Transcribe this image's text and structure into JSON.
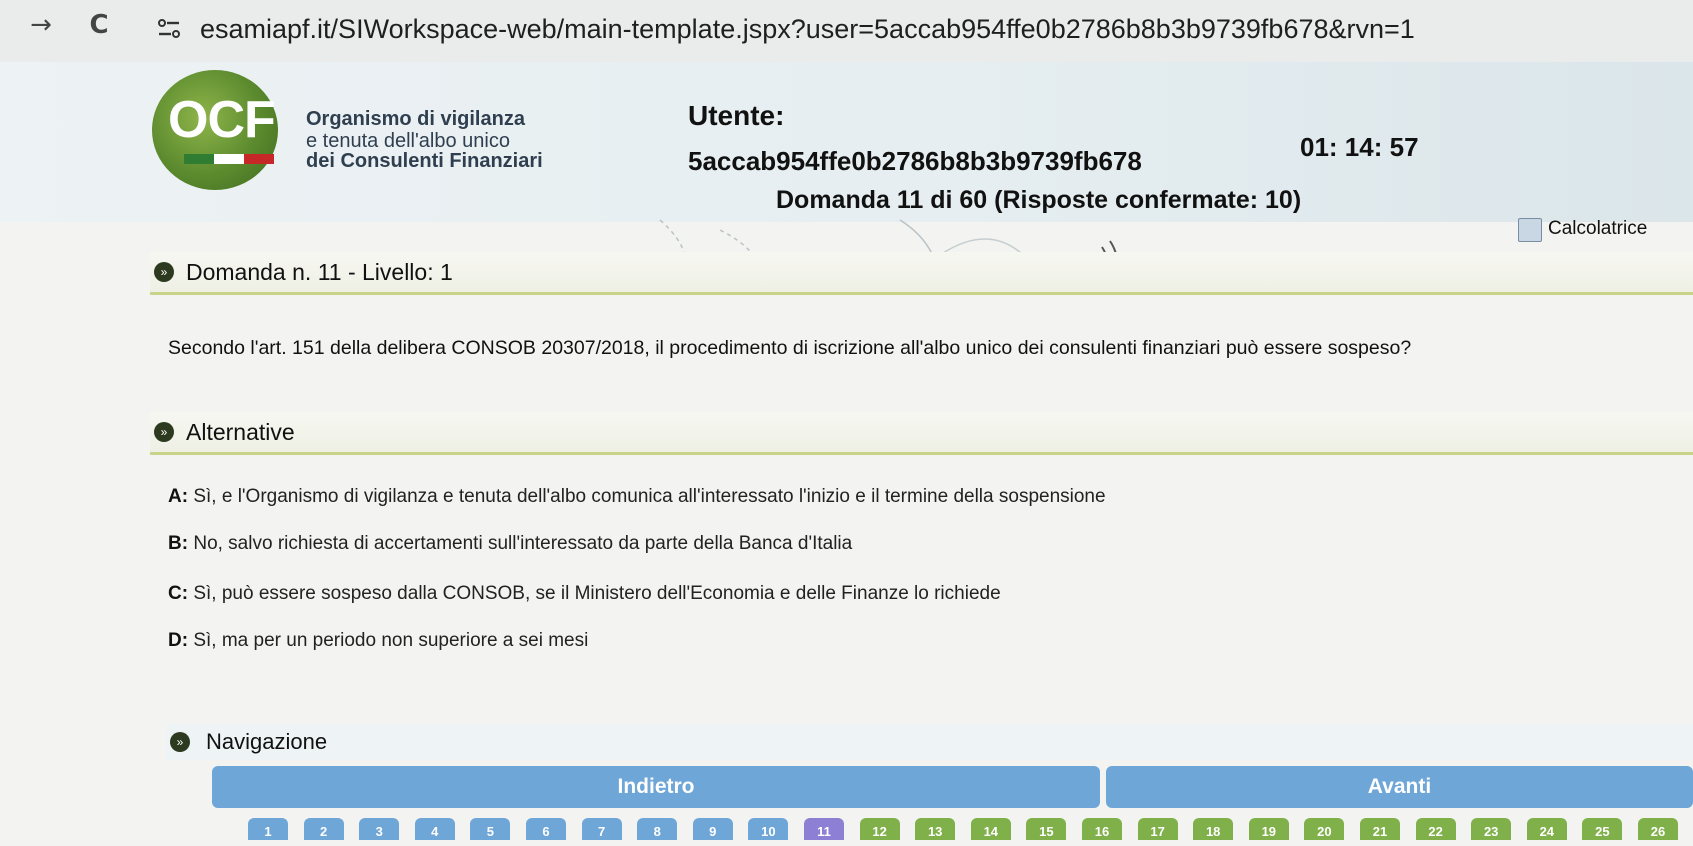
{
  "browser": {
    "back_icon": "→",
    "reload_icon": "C",
    "url": "esamiapf.it/SIWorkspace-web/main-template.jspx?user=5accab954ffe0b2786b8b3b9739fb678&rvn=1"
  },
  "header": {
    "logo_text": "OCF",
    "org_lines": [
      "Organismo di vigilanza",
      "e tenuta dell'albo unico",
      "dei Consulenti Finanziari"
    ],
    "utente_label": "Utente:",
    "utente_value": "5accab954ffe0b2786b8b3b9739fb678",
    "timer": "01: 14: 57",
    "counter": "Domanda 11 di 60 (Risposte confermate: 10)",
    "calc_label": "Calcolatrice"
  },
  "question": {
    "heading": "Domanda n. 11 - Livello: 1",
    "text": "Secondo l'art. 151 della delibera CONSOB 20307/2018, il procedimento di iscrizione all'albo unico dei consulenti finanziari può essere sospeso?"
  },
  "alternatives": {
    "heading": "Alternative",
    "items": [
      {
        "letter": "A:",
        "text": " Sì, e l'Organismo di vigilanza e tenuta dell'albo comunica all'interessato l'inizio e il termine della sospensione"
      },
      {
        "letter": "B:",
        "text": " No, salvo richiesta di accertamenti sull'interessato da parte della Banca d'Italia"
      },
      {
        "letter": "C:",
        "text": " Sì, può essere sospeso dalla CONSOB, se il Ministero dell'Economia e delle Finanze lo richiede"
      },
      {
        "letter": "D:",
        "text": " Sì, ma per un periodo non superiore a sei mesi"
      }
    ]
  },
  "navigation": {
    "heading": "Navigazione",
    "back_label": "Indietro",
    "next_label": "Avanti",
    "current": "11",
    "numbers": [
      "1",
      "2",
      "3",
      "4",
      "5",
      "6",
      "7",
      "8",
      "9",
      "10",
      "11",
      "12",
      "13",
      "14",
      "15",
      "16",
      "17",
      "18",
      "19",
      "20",
      "21",
      "22",
      "23",
      "24",
      "25",
      "26"
    ]
  },
  "colors": {
    "button": "#6fa6d8",
    "current_question": "#8d7fd3",
    "accent_green": "#7fb04a"
  }
}
